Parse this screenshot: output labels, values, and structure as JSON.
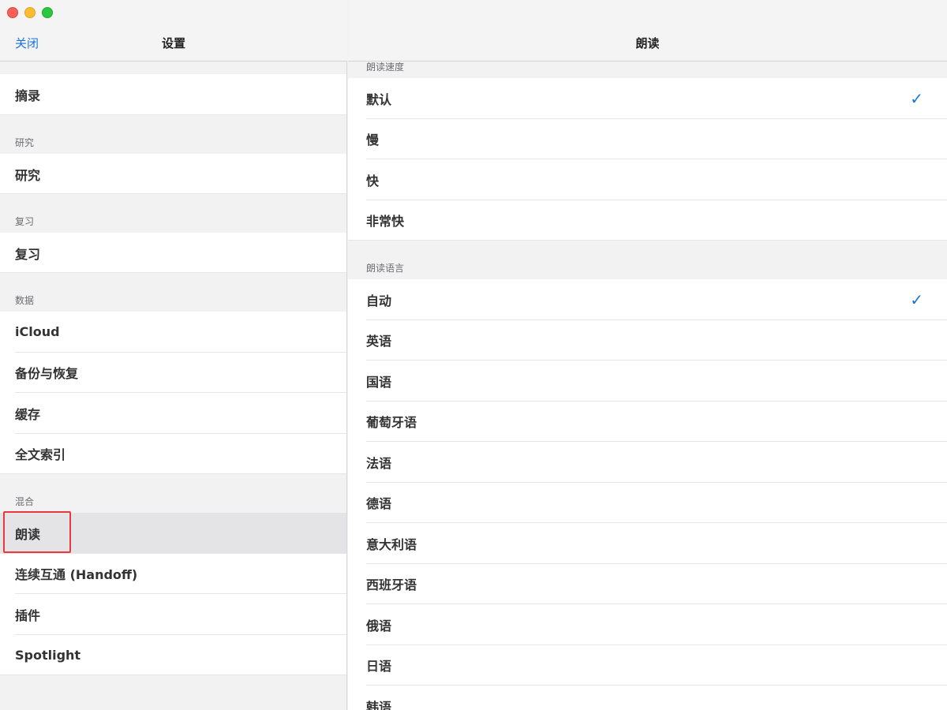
{
  "window": {
    "traffic_lights": [
      "close",
      "minimize",
      "zoom"
    ]
  },
  "left": {
    "close_label": "关闭",
    "title": "设置",
    "groups": [
      {
        "label": "",
        "items": [
          "摘录"
        ]
      },
      {
        "label": "研究",
        "items": [
          "研究"
        ]
      },
      {
        "label": "复习",
        "items": [
          "复习"
        ]
      },
      {
        "label": "数据",
        "items": [
          "iCloud",
          "备份与恢复",
          "缓存",
          "全文索引"
        ]
      },
      {
        "label": "混合",
        "items": [
          "朗读",
          "连续互通 (Handoff)",
          "插件",
          "Spotlight"
        ]
      }
    ],
    "selected_item": "朗读"
  },
  "right": {
    "title": "朗读",
    "speed": {
      "label": "朗读速度",
      "options": [
        "默认",
        "慢",
        "快",
        "非常快"
      ],
      "selected": "默认"
    },
    "language": {
      "label": "朗读语言",
      "options": [
        "自动",
        "英语",
        "国语",
        "葡萄牙语",
        "法语",
        "德语",
        "意大利语",
        "西班牙语",
        "俄语",
        "日语",
        "韩语"
      ],
      "selected": "自动"
    },
    "checkmark": "✓"
  },
  "colors": {
    "accent": "#1a73d9",
    "highlight_box": "#e8393f",
    "selected_row": "#e4e4e6"
  }
}
